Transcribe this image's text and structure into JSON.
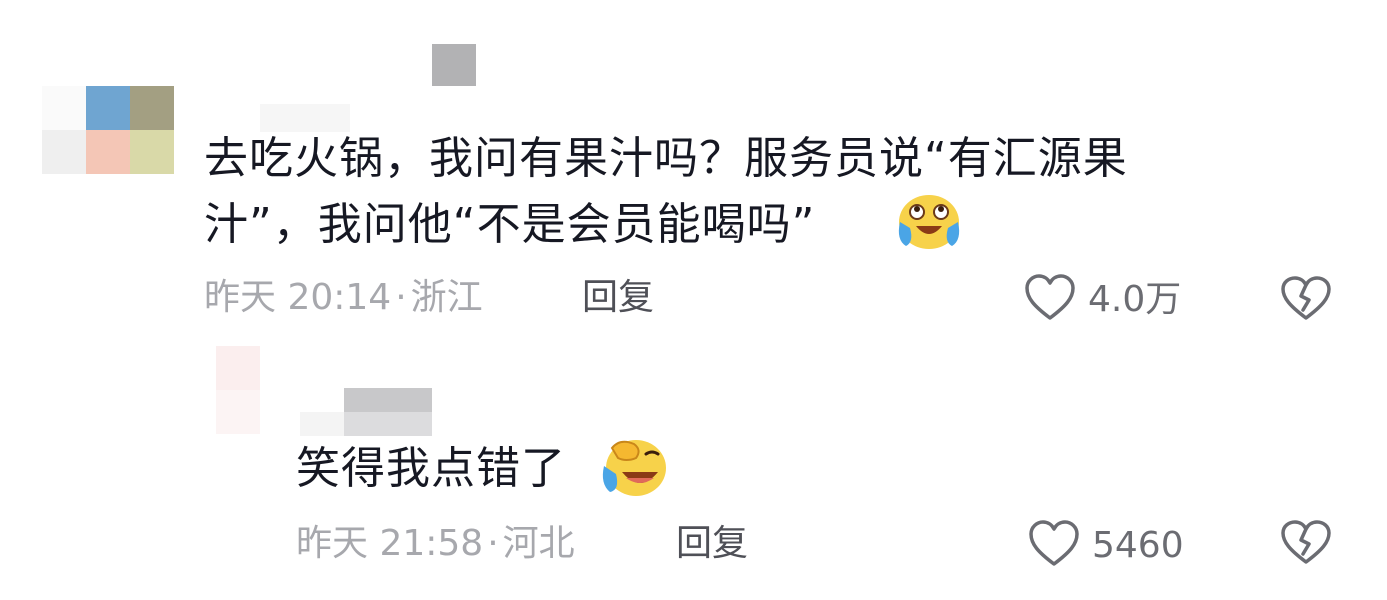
{
  "comments": [
    {
      "text_line1": "去吃火锅，我问有果汁吗？服务员说“有汇源果",
      "text_line2": "汁”，我问他“不是会员能喝吗”",
      "emoji": "crying-laughing-emoji",
      "time": "昨天 20:14",
      "separator": "·",
      "location": "浙江",
      "reply_label": "回复",
      "likes": "4.0万",
      "like_icon": "heart-outline-icon",
      "dislike_icon": "broken-heart-icon"
    },
    {
      "text_line1": "笑得我点错了",
      "emoji": "facepalm-laughing-emoji",
      "time": "昨天 21:58",
      "separator": "·",
      "location": "河北",
      "reply_label": "回复",
      "likes": "5460",
      "like_icon": "heart-outline-icon",
      "dislike_icon": "broken-heart-icon"
    }
  ],
  "colors": {
    "text": "#161823",
    "meta": "#a7a8ad",
    "reply": "#4f5057",
    "icon": "#6b6c72"
  }
}
